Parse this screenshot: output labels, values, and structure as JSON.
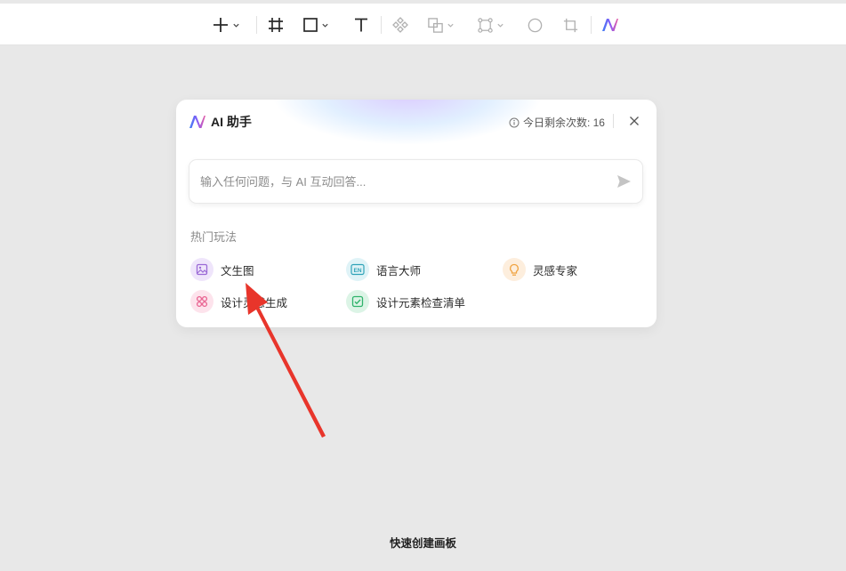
{
  "toolbar": {
    "tools": [
      {
        "icon": "plus-icon",
        "has_menu": true
      },
      {
        "icon": "frame-icon",
        "has_menu": false
      },
      {
        "icon": "rectangle-icon",
        "has_menu": true
      },
      {
        "icon": "text-icon",
        "has_menu": false
      },
      {
        "icon": "component-icon",
        "has_menu": false
      },
      {
        "icon": "boolean-icon",
        "has_menu": true
      },
      {
        "icon": "vector-edit-icon",
        "has_menu": true
      },
      {
        "icon": "ellipse-icon",
        "has_menu": false
      },
      {
        "icon": "crop-icon",
        "has_menu": false
      },
      {
        "icon": "ai-logo-icon",
        "has_menu": false
      }
    ]
  },
  "ai_panel": {
    "title": "AI 助手",
    "quota": "今日剩余次数: 16",
    "input_placeholder": "输入任何问题，与 AI 互动回答...",
    "section_title": "热门玩法",
    "features": [
      {
        "label": "文生图",
        "icon": "image-icon",
        "color": "#9b6ad6"
      },
      {
        "label": "语言大师",
        "icon": "translate-en-icon",
        "color": "#2fa3b8"
      },
      {
        "label": "灵感专家",
        "icon": "lightbulb-icon",
        "color": "#f0a341"
      },
      {
        "label": "设计灵感生成",
        "icon": "grid-icon",
        "color": "#e8608f"
      },
      {
        "label": "设计元素检查清单",
        "icon": "checklist-icon",
        "color": "#2fb36b"
      }
    ]
  },
  "canvas": {
    "quick_create_label": "快速创建画板"
  },
  "colors": {
    "toolbar_bg": "#ffffff",
    "canvas_bg": "#e8e8e8",
    "annotation_arrow": "#e8352b"
  }
}
